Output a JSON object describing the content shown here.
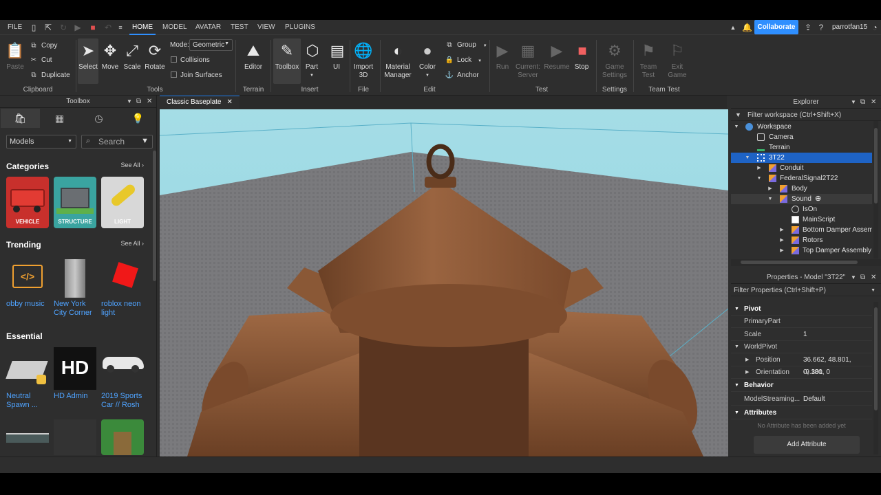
{
  "menu": {
    "file_label": "FILE",
    "tabs": [
      {
        "label": "HOME",
        "active": true
      },
      {
        "label": "MODEL"
      },
      {
        "label": "AVATAR"
      },
      {
        "label": "TEST"
      },
      {
        "label": "VIEW"
      },
      {
        "label": "PLUGINS"
      }
    ],
    "collaborate_label": "Collaborate",
    "username": "parrotfan15"
  },
  "ribbon": {
    "paste": "Paste",
    "copy": "Copy",
    "cut": "Cut",
    "duplicate": "Duplicate",
    "clipboard_group": "Clipboard",
    "select": "Select",
    "move": "Move",
    "scale": "Scale",
    "rotate": "Rotate",
    "mode_label": "Mode:",
    "mode_value": "Geometric",
    "collisions": "Collisions",
    "join_surfaces": "Join Surfaces",
    "tools_group": "Tools",
    "editor": "Editor",
    "terrain_group": "Terrain",
    "toolbox": "Toolbox",
    "part": "Part",
    "ui": "UI",
    "insert_group": "Insert",
    "import3d_1": "Import",
    "import3d_2": "3D",
    "file_group": "File",
    "material_1": "Material",
    "material_2": "Manager",
    "color": "Color",
    "group": "Group",
    "lock": "Lock",
    "anchor": "Anchor",
    "edit_group": "Edit",
    "run": "Run",
    "current_1": "Current:",
    "current_2": "Server",
    "resume": "Resume",
    "stop": "Stop",
    "test_group": "Test",
    "game_settings_1": "Game",
    "game_settings_2": "Settings",
    "settings_group": "Settings",
    "team_test_1": "Team",
    "team_test_2": "Test",
    "exit_game_1": "Exit",
    "exit_game_2": "Game",
    "team_test_group": "Team Test"
  },
  "toolbox": {
    "title": "Toolbox",
    "category_value": "Models",
    "search_placeholder": "Search",
    "categories_title": "Categories",
    "see_all": "See All ›",
    "categories": [
      {
        "label": "VEHICLE"
      },
      {
        "label": "STRUCTURE"
      },
      {
        "label": "LIGHT"
      }
    ],
    "trending_title": "Trending",
    "trending": [
      {
        "name1": "obby music",
        "name2": ""
      },
      {
        "name1": "New York",
        "name2": "City Corner"
      },
      {
        "name1": "roblox neon",
        "name2": "light"
      }
    ],
    "essential_title": "Essential",
    "essential": [
      {
        "name1": "Neutral",
        "name2": "Spawn ..."
      },
      {
        "name1": "HD Admin",
        "name2": ""
      },
      {
        "name1": "2019 Sports",
        "name2": "Car // Rosh"
      }
    ],
    "hd_text": "HD"
  },
  "viewport": {
    "tab_label": "Classic Baseplate"
  },
  "explorer": {
    "title": "Explorer",
    "filter_placeholder": "Filter workspace (Ctrl+Shift+X)",
    "items": [
      {
        "label": "Workspace"
      },
      {
        "label": "Camera"
      },
      {
        "label": "Terrain"
      },
      {
        "label": "3T22"
      },
      {
        "label": "Conduit"
      },
      {
        "label": "FederalSignal2T22"
      },
      {
        "label": "Body"
      },
      {
        "label": "Sound"
      },
      {
        "label": "IsOn"
      },
      {
        "label": "MainScript"
      },
      {
        "label": "Bottom Damper Assembly"
      },
      {
        "label": "Rotors"
      },
      {
        "label": "Top Damper Assembly"
      }
    ]
  },
  "properties": {
    "title": "Properties - Model \"3T22\"",
    "filter_placeholder": "Filter Properties (Ctrl+Shift+P)",
    "pivot_cat": "Pivot",
    "primary_part": "PrimaryPart",
    "scale_name": "Scale",
    "scale_value": "1",
    "world_pivot": "WorldPivot",
    "position_name": "Position",
    "position_value": "36.662, 48.801, -9.301",
    "orientation_name": "Orientation",
    "orientation_value": "0, 180, 0",
    "behavior_cat": "Behavior",
    "streaming_name": "ModelStreaming...",
    "streaming_value": "Default",
    "attributes_cat": "Attributes",
    "no_attr": "No Attribute has been added yet",
    "add_attr": "Add Attribute"
  }
}
